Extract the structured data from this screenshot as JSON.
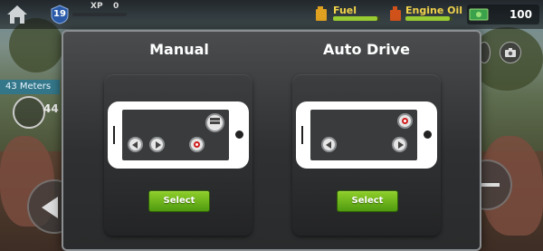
{
  "hud": {
    "level": "19",
    "xp_label": "XP",
    "xp_value": "0",
    "fuel_label": "Fuel",
    "fuel_level": 0.95,
    "oil_label": "Engine Oil",
    "oil_level": 0.95,
    "cash_value": "100",
    "distance": "43 Meters",
    "speed": "44"
  },
  "modal": {
    "modes": [
      {
        "title": "Manual",
        "select_label": "Select"
      },
      {
        "title": "Auto Drive",
        "select_label": "Select"
      }
    ]
  },
  "colors": {
    "select_green": "#6bb51c",
    "brake_red": "#d01d1d",
    "fuel_yellow": "#f0d24a",
    "meters_blue": "#2878b4"
  },
  "icons": [
    "home-icon",
    "level-shield-icon",
    "fuel-can-icon",
    "oil-can-icon",
    "cash-icon",
    "camera-icon",
    "steer-left-icon",
    "steer-right-icon",
    "brake-icon",
    "pedal-icon"
  ]
}
